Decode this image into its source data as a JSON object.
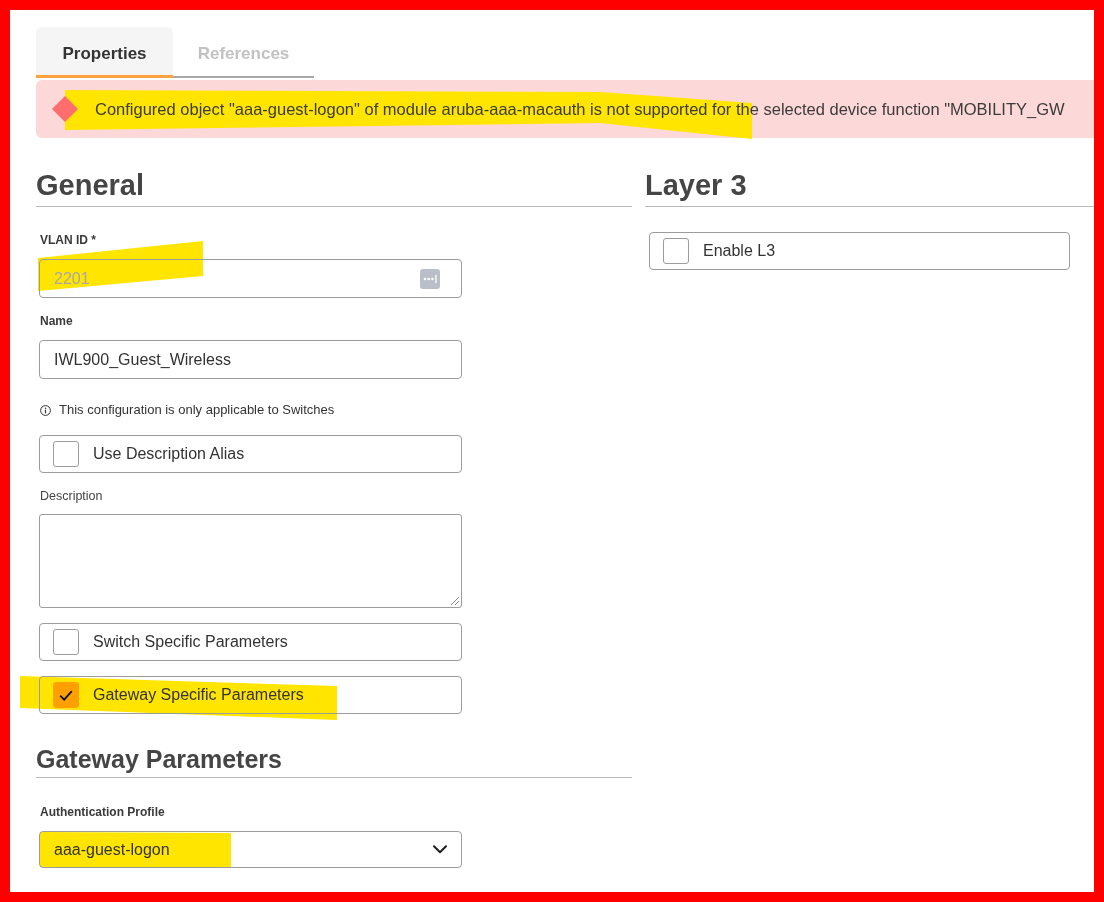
{
  "tabs": [
    {
      "label": "Properties",
      "selected": true
    },
    {
      "label": "References",
      "selected": false
    }
  ],
  "alert": {
    "kind": "error",
    "message": "Configured object \"aaa-guest-logon\" of module aruba-aaa-macauth is not supported for the selected device function \"MOBILITY_GW",
    "highlighted": true
  },
  "general": {
    "title": "General",
    "fields": [
      {
        "kind": "text",
        "label": "VLAN ID *",
        "value": "2201",
        "disabled": true,
        "menu_icon": true,
        "highlighted": true
      },
      {
        "kind": "text",
        "label": "Name",
        "value": "IWL900_Guest_Wireless",
        "disabled": false
      },
      {
        "kind": "note",
        "text": "This configuration is only applicable to Switches"
      },
      {
        "kind": "checkbox",
        "label": "Use Description Alias",
        "checked": false
      },
      {
        "kind": "textarea",
        "label": "Description"
      },
      {
        "kind": "checkbox",
        "label": "Switch Specific Parameters",
        "checked": false
      },
      {
        "kind": "checkbox",
        "label": "Gateway Specific Parameters",
        "checked": true,
        "highlighted": true
      }
    ],
    "subsections": [
      {
        "title": "Gateway Parameters",
        "fields": [
          {
            "kind": "select",
            "label": "Authentication Profile",
            "value": "aaa-guest-logon",
            "highlighted": true
          }
        ]
      }
    ]
  },
  "layer3": {
    "title": "Layer 3",
    "fields": [
      {
        "kind": "checkbox",
        "label": "Enable L3",
        "checked": false
      }
    ]
  }
}
